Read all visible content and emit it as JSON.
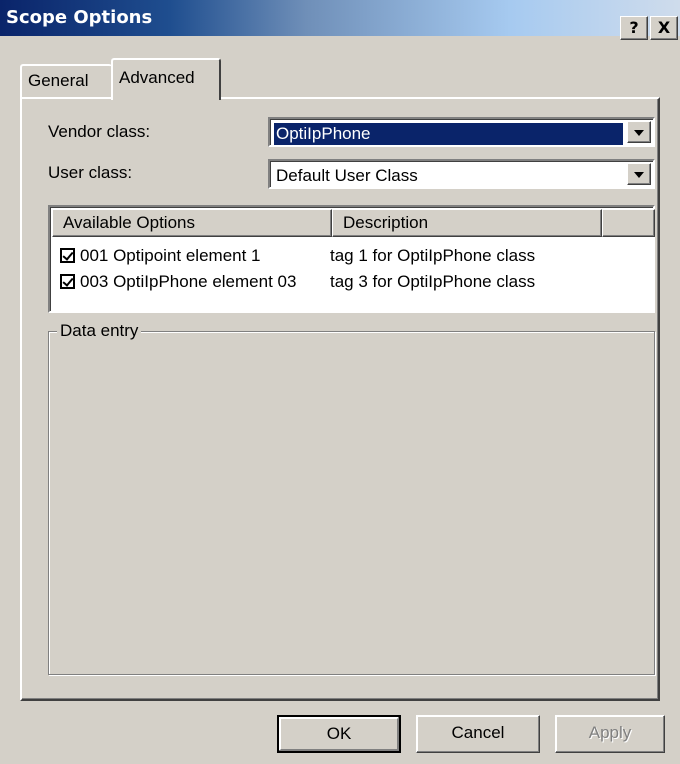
{
  "window": {
    "title": "Scope Options",
    "help_glyph": "?",
    "close_glyph": "X"
  },
  "tabs": [
    {
      "label": "General"
    },
    {
      "label": "Advanced",
      "active": true
    }
  ],
  "form": {
    "vendor_label": "Vendor class:",
    "vendor_value": "OptiIpPhone",
    "user_label": "User class:",
    "user_value": "Default User Class"
  },
  "options_list": {
    "columns": [
      "Available Options",
      "Description",
      ""
    ],
    "rows": [
      {
        "checked": true,
        "name": "001 Optipoint element 1",
        "description": "tag 1 for OptiIpPhone class"
      },
      {
        "checked": true,
        "name": "003 OptiIpPhone element 03",
        "description": "tag 3 for OptiIpPhone class"
      }
    ]
  },
  "data_entry": {
    "legend": "Data entry"
  },
  "buttons": {
    "ok": "OK",
    "cancel": "Cancel",
    "apply": "Apply"
  },
  "colors": {
    "face": "#d4d0c8",
    "selection": "#0a246a",
    "title_gradient_start": "#0a246a",
    "title_gradient_end": "#a6caf0"
  }
}
